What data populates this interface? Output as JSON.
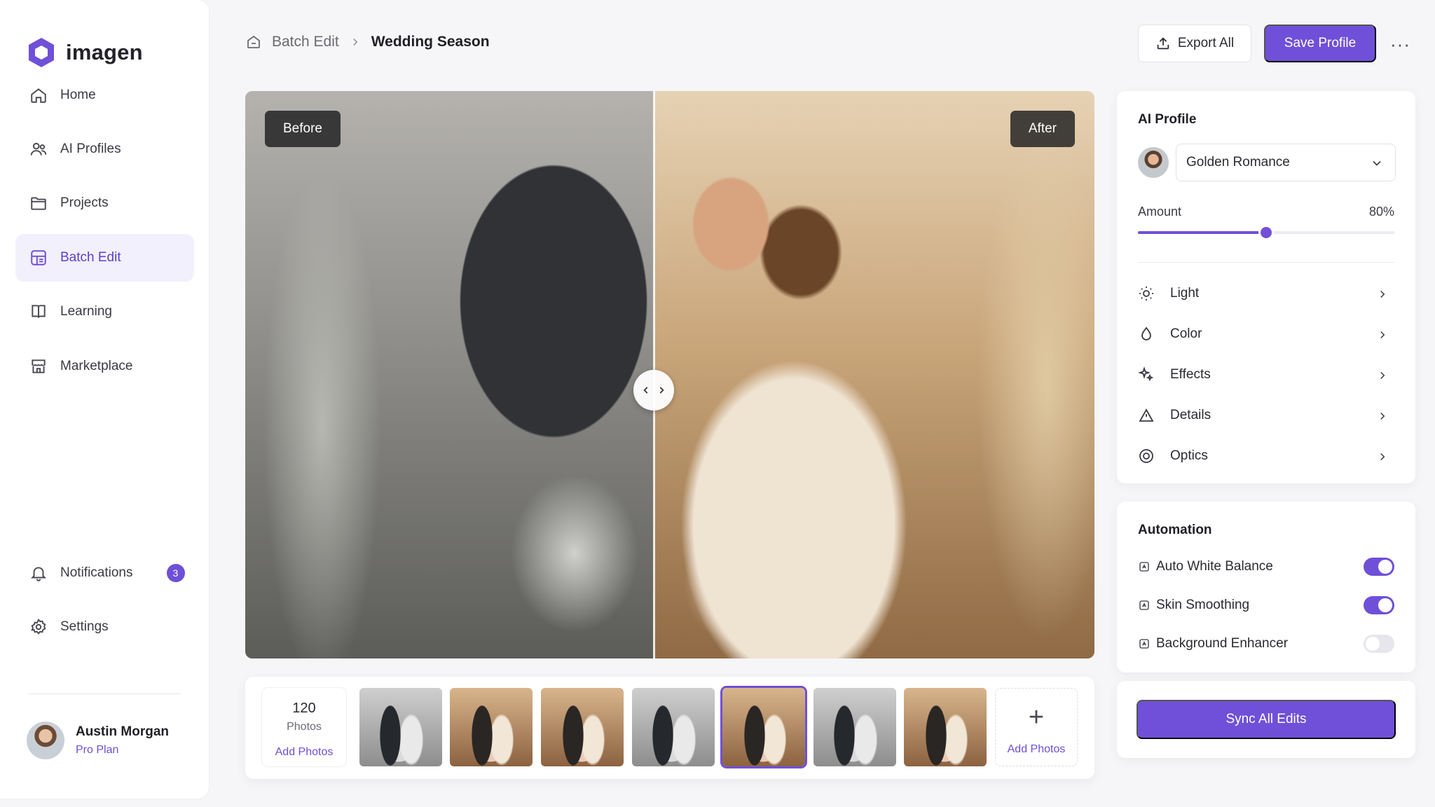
{
  "app": {
    "name": "imagen",
    "accent": "#7050d8"
  },
  "sidebar": {
    "items": [
      {
        "label": "Home",
        "icon": "home-icon"
      },
      {
        "label": "AI Profiles",
        "icon": "users-icon"
      },
      {
        "label": "Projects",
        "icon": "folder-icon"
      },
      {
        "label": "Batch Edit",
        "icon": "batch-edit-icon",
        "active": true
      },
      {
        "label": "Learning",
        "icon": "book-icon"
      },
      {
        "label": "Marketplace",
        "icon": "store-icon"
      }
    ],
    "notifications": {
      "label": "Notifications",
      "count": "3"
    },
    "settings": {
      "label": "Settings"
    },
    "user": {
      "name": "Austin Morgan",
      "plan": "Pro Plan"
    }
  },
  "header": {
    "breadcrumb": [
      "Batch Edit",
      "Wedding Season"
    ],
    "export_label": "Export All",
    "save_label": "Save Profile",
    "more_label": "···"
  },
  "viewer": {
    "before_label": "Before",
    "after_label": "After",
    "split_position": 0.48
  },
  "filmstrip": {
    "count": "120",
    "count_label": "Photos",
    "add_label": "Add Photos",
    "thumbs": [
      {
        "tone": "bw"
      },
      {
        "tone": "warm"
      },
      {
        "tone": "warm"
      },
      {
        "tone": "bw"
      },
      {
        "tone": "warm",
        "selected": true
      },
      {
        "tone": "bw"
      },
      {
        "tone": "warm"
      }
    ],
    "add_card_label": "Add Photos"
  },
  "profile_panel": {
    "title": "AI Profile",
    "selected_profile": "Golden Romance",
    "amount_label": "Amount",
    "amount_value": "80%",
    "amount_fraction": 0.5,
    "adjustments": [
      {
        "label": "Light",
        "icon": "sun-icon"
      },
      {
        "label": "Color",
        "icon": "drop-icon"
      },
      {
        "label": "Effects",
        "icon": "sparkle-icon"
      },
      {
        "label": "Details",
        "icon": "triangle-icon"
      },
      {
        "label": "Optics",
        "icon": "lens-icon"
      }
    ]
  },
  "automation_panel": {
    "title": "Automation",
    "options": [
      {
        "label": "Auto White Balance",
        "on": true
      },
      {
        "label": "Skin Smoothing",
        "on": true
      },
      {
        "label": "Background Enhancer",
        "on": false
      }
    ]
  },
  "sync": {
    "label": "Sync All Edits"
  }
}
